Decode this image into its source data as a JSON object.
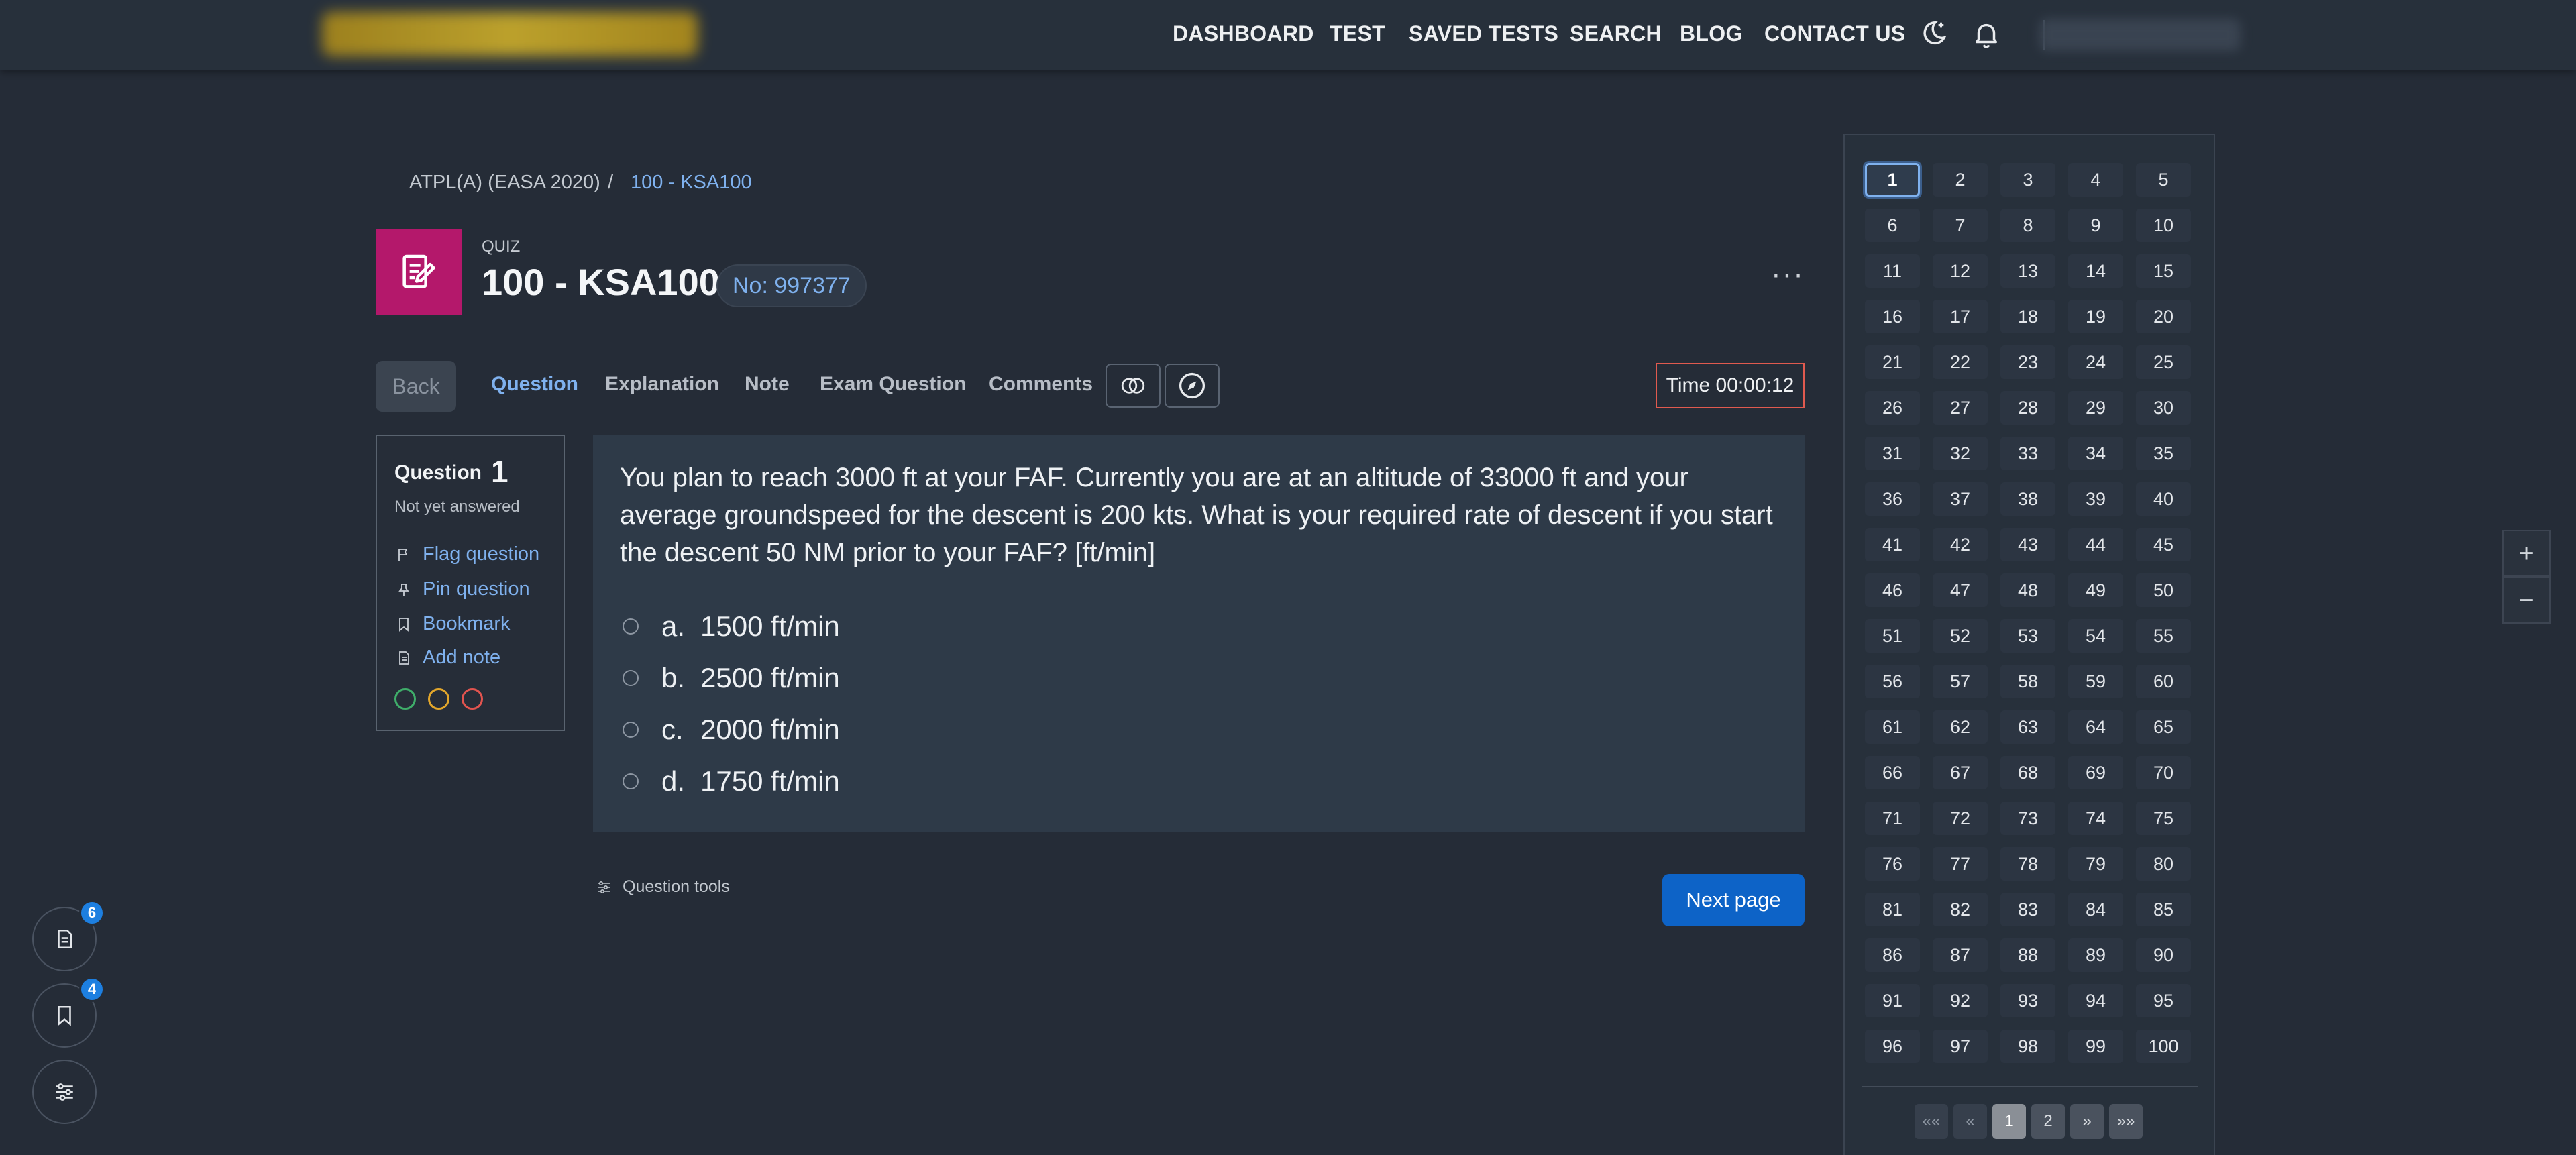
{
  "nav": {
    "items": [
      "DASHBOARD",
      "TEST",
      "SAVED TESTS",
      "SEARCH",
      "BLOG",
      "CONTACT US"
    ],
    "icons": [
      "theme-moon-icon",
      "bell-icon"
    ]
  },
  "breadcrumb": {
    "root": "ATPL(A) (EASA 2020)",
    "separator": "/",
    "current": "100 - KSA100"
  },
  "header": {
    "label": "QUIZ",
    "title": "100 - KSA100",
    "number": "No: 997377",
    "more": "···"
  },
  "tabs": {
    "back": "Back",
    "items": [
      "Question",
      "Explanation",
      "Note",
      "Exam Question",
      "Comments"
    ],
    "active": "Question",
    "timer": "Time 00:00:12"
  },
  "info": {
    "label": "Question",
    "number": "1",
    "status": "Not yet answered",
    "links": [
      "Flag question",
      "Pin question",
      "Bookmark",
      "Add note"
    ],
    "dot_colors": [
      "#3fae6a",
      "#e3a72b",
      "#e2544f"
    ]
  },
  "question": {
    "text": "You plan to reach 3000 ft at your FAF. Currently you are at an altitude of 33000 ft and your average groundspeed for the descent is 200 kts. What is your required rate of descent if you start the descent 50 NM prior to your FAF? [ft/min]",
    "answers": [
      {
        "letter": "a.",
        "text": "1500 ft/min"
      },
      {
        "letter": "b.",
        "text": "2500 ft/min"
      },
      {
        "letter": "c.",
        "text": "2000 ft/min"
      },
      {
        "letter": "d.",
        "text": "1750 ft/min"
      }
    ],
    "tools": "Question tools",
    "next": "Next page"
  },
  "navigator": {
    "count": 100,
    "current": 1,
    "pagination": [
      "««",
      "«",
      "1",
      "2",
      "»",
      "»»"
    ],
    "active_page": "1"
  },
  "zoom": {
    "plus": "+",
    "minus": "−"
  },
  "floating": {
    "notes_badge": "6",
    "bookmarks_badge": "4"
  },
  "colors": {
    "accent": "#7fb1ee",
    "primary_button": "#0d63c7",
    "quiz_tile": "#b4186b",
    "timer_border": "#e05a4f"
  }
}
